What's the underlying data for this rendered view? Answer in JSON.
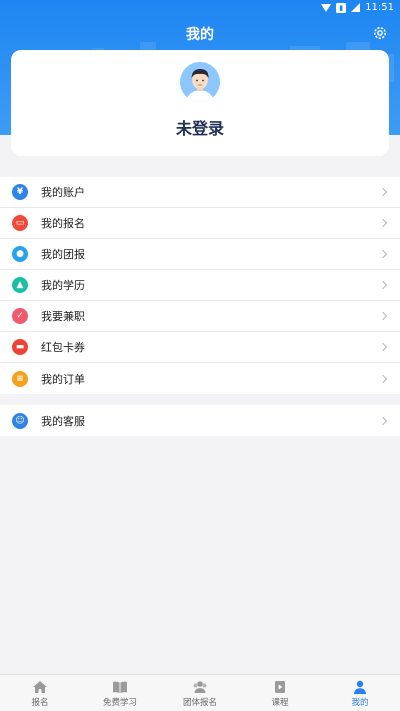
{
  "status": {
    "time": "11:51"
  },
  "header": {
    "title": "我的"
  },
  "profile": {
    "login_text": "未登录"
  },
  "menu_main": [
    {
      "label": "我的账户",
      "icon": "yen-icon",
      "color": "#2f84e8"
    },
    {
      "label": "我的报名",
      "icon": "registration-card-icon",
      "color": "#f04c3e"
    },
    {
      "label": "我的团报",
      "icon": "group-icon",
      "color": "#25a3ef"
    },
    {
      "label": "我的学历",
      "icon": "graduation-cap-icon",
      "color": "#1bbfa5"
    },
    {
      "label": "我要兼职",
      "icon": "part-time-icon",
      "color": "#ef5b6c"
    },
    {
      "label": "红包卡券",
      "icon": "coupon-icon",
      "color": "#ef4136"
    },
    {
      "label": "我的订单",
      "icon": "order-icon",
      "color": "#f6a11b"
    }
  ],
  "menu_service": [
    {
      "label": "我的客服",
      "icon": "customer-service-icon",
      "color": "#2f84e8"
    }
  ],
  "tabbar": [
    {
      "label": "报名",
      "icon": "home-icon",
      "active": false
    },
    {
      "label": "免费学习",
      "icon": "book-icon",
      "active": false
    },
    {
      "label": "团体报名",
      "icon": "group-tab-icon",
      "active": false
    },
    {
      "label": "课程",
      "icon": "course-icon",
      "active": false
    },
    {
      "label": "我的",
      "icon": "profile-icon",
      "active": true
    }
  ],
  "colors": {
    "primary": "#1e86f2",
    "tab_active": "#2b7ff0",
    "name_text": "#1f2f55"
  }
}
